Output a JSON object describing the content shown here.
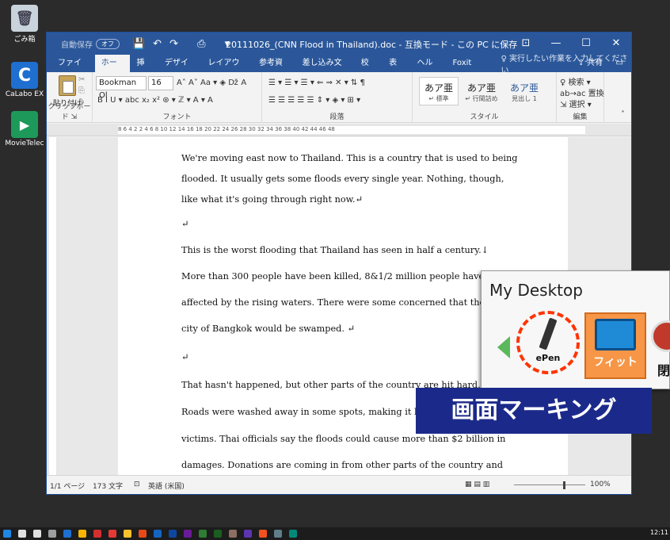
{
  "desktop": {
    "icons": [
      {
        "label": "ごみ箱",
        "icon": "recycle-bin-icon",
        "color": "#c9d3dc"
      },
      {
        "label": "CaLabo EX",
        "icon": "calabo-icon",
        "color": "#1e6fd0"
      },
      {
        "label": "MovieTelec",
        "icon": "movietele-icon",
        "color": "#1d9a5a"
      }
    ]
  },
  "word": {
    "title": {
      "autosave": "自動保存",
      "autosave_state": "オフ",
      "doc_title": "20111026_(CNN Flood in Thailand).doc - 互換モード - この PC に保存",
      "controls": [
        "⊡",
        "—",
        "☐",
        "✕"
      ]
    },
    "tabs": [
      "ファイル",
      "ホーム",
      "挿入",
      "デザイン",
      "レイアウト",
      "参考資料",
      "差し込み文書",
      "校閲",
      "表示",
      "ヘルプ",
      "Foxit PDF"
    ],
    "active_tab": "ホーム",
    "tell_me": "♀ 実行したい作業を入力してください",
    "share": "⇪ 共有",
    "ribbon": {
      "paste_label": "貼り付け",
      "font_name": "Bookman Ol",
      "font_size": "16",
      "font_row1": "A˄ A˅  Aa ▾  ◈  ǅ  A",
      "font_row2": "B  I  U ▾  abc  x₂  x²  ⊛ ▾  ℤ ▾  A ▾  A",
      "para_row1": "☰ ▾  ☰ ▾  ☰ ▾  ⇐  ⇒  ✕ ▾  ⇅  ¶",
      "para_row2": "☰  ☰  ☰  ☰  ☰  ⇕ ▾  ◈ ▾  ⊞ ▾",
      "group_labels": [
        "クリップボード ⇲",
        "フォント",
        "段落",
        "スタイル",
        "編集"
      ],
      "styles": [
        {
          "big": "あア亜",
          "small": "↵ 標準"
        },
        {
          "big": "あア亜",
          "small": "↵ 行間詰め"
        },
        {
          "big": "あア亜",
          "small": "見出し 1"
        }
      ],
      "edit_items": [
        "♀ 検索 ▾",
        "ab→ac 置換",
        "⇲ 選択 ▾"
      ]
    },
    "ruler_text": "8  6  4  2     2  4  6  8  10  12  14  16  18  20  22  24  26  28  30  32  34  36  38  40  42  44  46  48",
    "document_lines": [
      "We're moving east now to Thailand. This is a country that is used to being",
      "flooded.   It usually gets some floods every single year.   Nothing, though,",
      "like what it's going through right now.↵",
      "↵",
      "This is the worst flooding that Thailand has seen in half a century.↓",
      "More than 300 people have been killed, 8&1/2 million people have been",
      "affected by the rising waters. There were some concerned that the capital",
      "city of Bangkok would be swamped.  ↵",
      "↵",
      "That hasn't happened, but other parts of the country are hit hard.",
      "Roads were washed away in some spots, making it hard to get help to",
      "victims. Thai officials say the floods could cause more than $2 billion in",
      "damages. Donations are coming in from other parts of the country and"
    ],
    "status": {
      "page": "1/1 ページ",
      "words": "173 文字",
      "lang_icon": "⊡",
      "lang": "英語 (米国)",
      "zoom": "100%",
      "view_icons": "▦  ▤  ▥"
    }
  },
  "overlay": {
    "title": "My Desktop",
    "pen_label": "ePen",
    "fit_label": "フィット",
    "third_label": "閉"
  },
  "banner": "画面マーキング",
  "taskbar": {
    "clock": "12:11",
    "icons": [
      "#1e88e5",
      "#e0e0e0",
      "#e0e0e0",
      "#9e9e9e",
      "#1e6fd0",
      "#f7b500",
      "#d32f2f",
      "#e53935",
      "#fbc02d",
      "#e64a19",
      "#1565c0",
      "#0d47a1",
      "#6a1b9a",
      "#2e7d32",
      "#1b5e20",
      "#8d6e63",
      "#5e35b1",
      "#f4511e",
      "#607d8b",
      "#00897b"
    ]
  }
}
